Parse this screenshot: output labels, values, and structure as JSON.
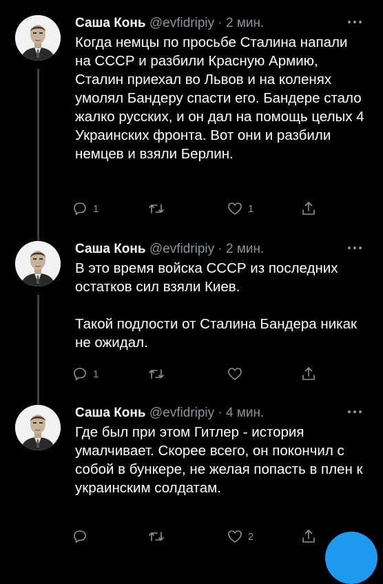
{
  "tweets": [
    {
      "name": "Саша Конь",
      "handle": "@evfidripiy",
      "separator": "·",
      "time": "2 мин.",
      "paragraphs": [
        "Когда немцы по просьбе Сталина напали на СССР и разбили Красную Армию, Сталин приехал во Львов и на коленях умолял Бандеру спасти его. Бандере стало жалко русских, и он дал на помощь целых 4 Украинских фронта. Вот они и разбили немцев и взяли Берлин."
      ],
      "replies": "1",
      "retweets": "",
      "likes": "1"
    },
    {
      "name": "Саша Конь",
      "handle": "@evfidripiy",
      "separator": "·",
      "time": "2 мин.",
      "paragraphs": [
        "В это время войска СССР из последних остатков сил взяли Киев.",
        "Такой подлости от Сталина Бандера никак не ожидал."
      ],
      "replies": "1",
      "retweets": "",
      "likes": ""
    },
    {
      "name": "Саша Конь",
      "handle": "@evfidripiy",
      "separator": "·",
      "time": "4 мин.",
      "paragraphs": [
        "Где был при этом Гитлер - история умалчивает. Скорее всего, он покончил с собой в бункере, не желая попасть в плен к украинским солдатам."
      ],
      "replies": "",
      "retweets": "",
      "likes": "2"
    }
  ],
  "icons": {
    "reply": "reply-icon",
    "retweet": "retweet-icon",
    "like": "heart-icon",
    "share": "share-icon",
    "more": "more-icon"
  },
  "colors": {
    "background": "#000000",
    "text": "#ffffff",
    "secondary": "#8b9399",
    "accent": "#1d9bf0"
  }
}
